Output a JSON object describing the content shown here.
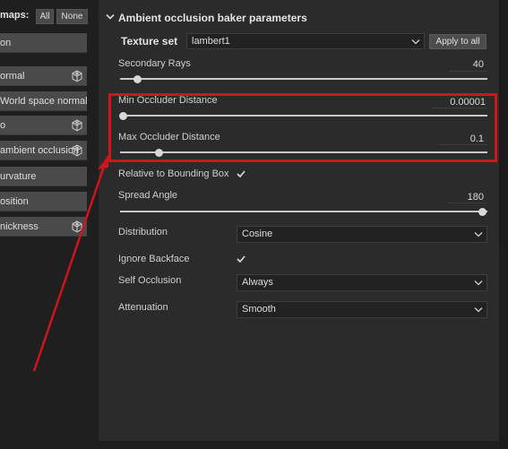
{
  "left": {
    "maps_label": "maps:",
    "all_button": "All",
    "none_button": "None",
    "items": [
      {
        "label": "on",
        "has_cube": false
      },
      {
        "label": "ormal",
        "has_cube": true
      },
      {
        "label": "World space normal",
        "has_cube": false
      },
      {
        "label": "o",
        "has_cube": true
      },
      {
        "label": "ambient occlusion",
        "has_cube": true
      },
      {
        "label": "urvature",
        "has_cube": false
      },
      {
        "label": "osition",
        "has_cube": false
      },
      {
        "label": "nickness",
        "has_cube": true
      }
    ]
  },
  "panel": {
    "title": "Ambient occlusion baker parameters",
    "texture_set_label": "Texture set",
    "texture_set_value": "lambert1",
    "apply_button": "Apply to all",
    "secondary_rays_label": "Secondary Rays",
    "secondary_rays_value": "40",
    "min_occluder_label": "Min Occluder Distance",
    "min_occluder_value": "0.00001",
    "max_occluder_label": "Max Occluder Distance",
    "max_occluder_value": "0.1",
    "relative_bbox_label": "Relative to Bounding Box",
    "spread_angle_label": "Spread Angle",
    "spread_angle_value": "180",
    "distribution_label": "Distribution",
    "distribution_value": "Cosine",
    "ignore_backface_label": "Ignore Backface",
    "self_occlusion_label": "Self Occlusion",
    "self_occlusion_value": "Always",
    "attenuation_label": "Attenuation",
    "attenuation_value": "Smooth"
  },
  "colors": {
    "highlight": "#d0141b",
    "panel_bg": "#2b2b2b"
  },
  "icons": [
    "chevron-down-icon",
    "cube-icon",
    "checkmark-icon"
  ]
}
